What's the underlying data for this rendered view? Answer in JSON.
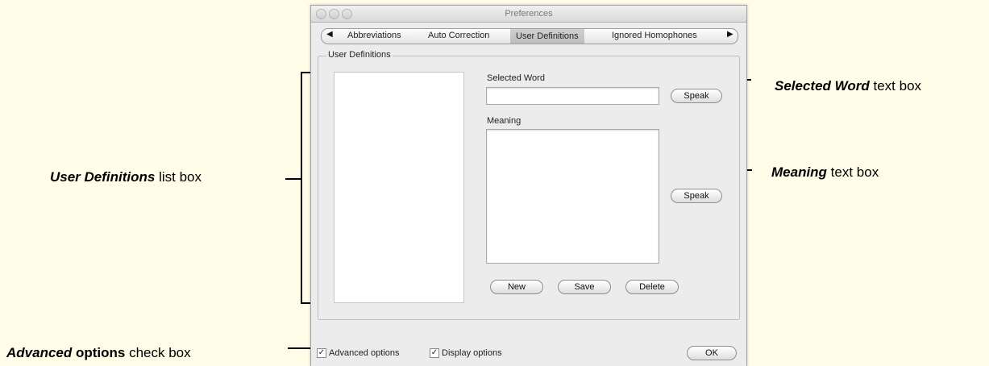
{
  "window": {
    "title": "Preferences",
    "tabs": [
      {
        "label": "Abbreviations",
        "selected": false
      },
      {
        "label": "Auto Correction",
        "selected": false
      },
      {
        "label": "User Definitions",
        "selected": true
      },
      {
        "label": "Ignored Homophones",
        "selected": false
      }
    ],
    "tab_left_arrow": "◀",
    "tab_right_arrow": "▶",
    "group_label": "User Definitions",
    "selected_word_label": "Selected Word",
    "selected_word_value": "",
    "meaning_label": "Meaning",
    "meaning_value": "",
    "speak_word_button": "Speak",
    "speak_meaning_button": "Speak",
    "new_button": "New",
    "save_button": "Save",
    "delete_button": "Delete",
    "advanced_options_label": "Advanced options",
    "advanced_options_checked": true,
    "display_options_label": "Display options",
    "display_options_checked": true,
    "ok_button": "OK"
  },
  "callouts": {
    "user_definitions_bold": "User Definitions",
    "user_definitions_rest": " list box",
    "selected_word_bold": "Selected Word",
    "selected_word_rest": " text box",
    "meaning_bold": "Meaning",
    "meaning_rest": " text box",
    "advanced_bold": "Advanced",
    "advanced_rest": " options check box"
  },
  "colors": {
    "background": "#fffde7",
    "window": "#ececec"
  },
  "check_glyph": "✓"
}
